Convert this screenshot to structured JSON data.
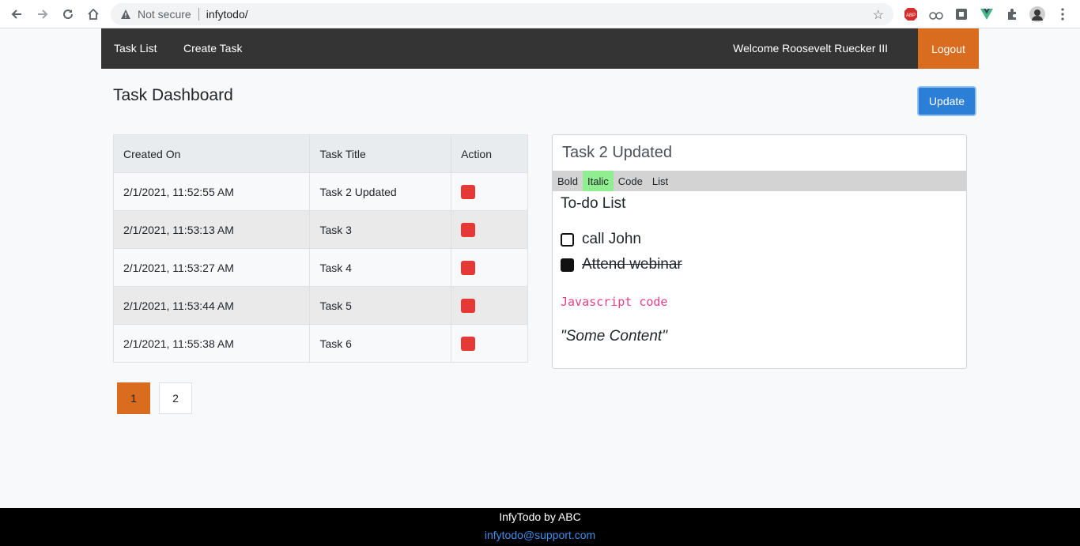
{
  "browser": {
    "security_text": "Not secure",
    "url": "infytodo/",
    "icons": [
      "back-icon",
      "forward-icon",
      "reload-icon",
      "home-icon",
      "warning-icon",
      "star-icon",
      "adblock-icon",
      "extension-icon",
      "extension-icon",
      "vue-icon",
      "puzzle-icon",
      "avatar",
      "menu-icon"
    ],
    "adblock_label": "ABP"
  },
  "navbar": {
    "links": [
      "Task List",
      "Create Task"
    ],
    "welcome": "Welcome Roosevelt Ruecker III",
    "logout": "Logout",
    "bg": "#343434",
    "accent": "#d96c1f"
  },
  "page": {
    "title": "Task Dashboard",
    "update_label": "Update",
    "update_color": "#2b7fd6"
  },
  "table": {
    "headers": [
      "Created On",
      "Task Title",
      "Action"
    ],
    "rows": [
      {
        "created": "2/1/2021, 11:52:55 AM",
        "title": "Task 2 Updated"
      },
      {
        "created": "2/1/2021, 11:53:13 AM",
        "title": "Task 3"
      },
      {
        "created": "2/1/2021, 11:53:27 AM",
        "title": "Task 4"
      },
      {
        "created": "2/1/2021, 11:53:44 AM",
        "title": "Task 5"
      },
      {
        "created": "2/1/2021, 11:55:38 AM",
        "title": "Task 6"
      }
    ],
    "delete_color": "#e53935"
  },
  "pagination": {
    "pages": [
      "1",
      "2"
    ],
    "current": "1"
  },
  "editor": {
    "title_value": "Task 2 Updated",
    "toolbar": [
      "Bold",
      "Italic",
      "Code",
      "List"
    ],
    "active_tool": "Italic",
    "heading": "To-do List",
    "todos": [
      {
        "text": "call John",
        "checked": false
      },
      {
        "text": "Attend webinar",
        "checked": true
      }
    ],
    "code": "Javascript code",
    "quote": "\"Some Content\""
  },
  "footer": {
    "brand": "InfyTodo by ABC",
    "email": "infytodo@support.com"
  }
}
